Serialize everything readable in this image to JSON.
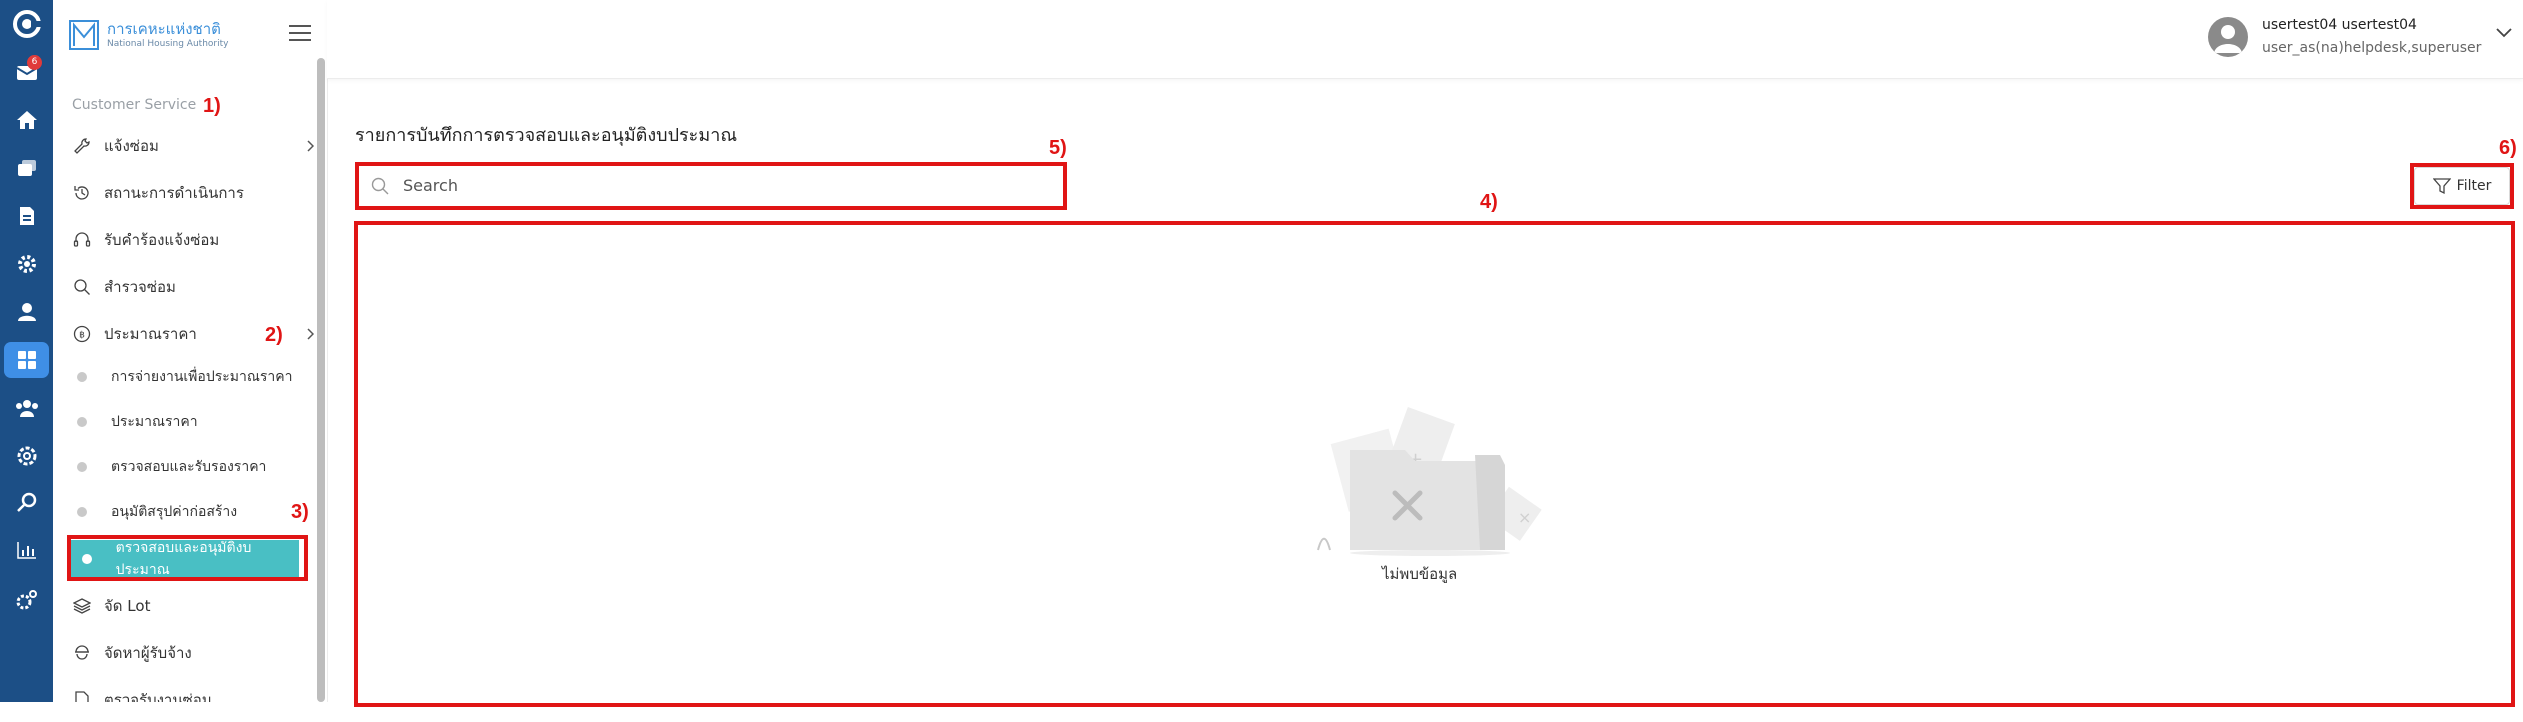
{
  "rail": {
    "badge_count": "6",
    "icons": [
      "app-logo-icon",
      "mail-icon",
      "home-icon",
      "layers-icon",
      "document-icon",
      "gear-flower-icon",
      "user-icon",
      "dashboard-icon",
      "team-icon",
      "settings-icon",
      "search-icon",
      "bar-chart-icon",
      "tools-icon"
    ]
  },
  "sidebar": {
    "logo_th": "การเคหะแห่งชาติ",
    "logo_en": "National Housing Authority",
    "section_label": "Customer Service",
    "items": [
      {
        "label": "แจ้งซ่อม",
        "icon": "wrench-icon"
      },
      {
        "label": "สถานะการดำเนินการ",
        "icon": "history-icon"
      },
      {
        "label": "รับคำร้องแจ้งซ่อม",
        "icon": "headset-icon"
      },
      {
        "label": "สำรวจซ่อม",
        "icon": "search-icon"
      },
      {
        "label": "ประมาณราคา",
        "icon": "baht-circle-icon"
      }
    ],
    "sub_items": [
      {
        "label": "การจ่ายงานเพื่อประมาณราคา"
      },
      {
        "label": "ประมาณราคา"
      },
      {
        "label": "ตรวจสอบและรับรองราคา"
      },
      {
        "label": "อนุมัติสรุปค่าก่อสร้าง"
      }
    ],
    "active_sub": "ตรวจสอบและอนุมัติงบประมาณ",
    "lower_items": [
      {
        "label": "จัด Lot",
        "icon": "stack-icon"
      },
      {
        "label": "จัดหาผู้รับจ้าง",
        "icon": "worker-icon"
      },
      {
        "label": "ตรวจรับงานซ่อม",
        "icon": "check-document-icon"
      }
    ]
  },
  "header": {
    "user_name": "usertest04 usertest04",
    "user_role": "user_as(na)helpdesk,superuser"
  },
  "main": {
    "title": "รายการบันทึกการตรวจสอบและอนุมัติงบประมาณ",
    "search_placeholder": "Search",
    "filter_label": "Filter",
    "empty_text": "ไม่พบข้อมูล"
  },
  "annotations": {
    "labels": [
      "1)",
      "2)",
      "3)",
      "4)",
      "5)",
      "6)"
    ],
    "color": "#e01515"
  },
  "colors": {
    "rail_bg": "#1c4f86",
    "rail_active": "#3f8fe6",
    "active_sub_bg": "#49bfc4",
    "logo_blue": "#3b8fd9"
  }
}
